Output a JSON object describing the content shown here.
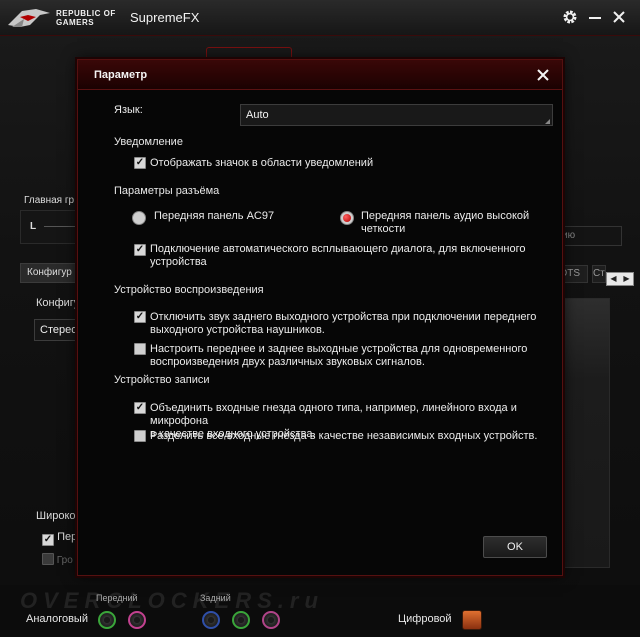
{
  "app": {
    "brand_line1": "REPUBLIC OF",
    "brand_line2": "GAMERS",
    "title": "SupremeFX",
    "main_group_label": "Главная гр",
    "slider_left_label": "L",
    "right_box_text": "анию",
    "tab_config": "Конфигур",
    "tab_dts": "DTS",
    "tab_extra": "Ст",
    "config_label": "Конфигу",
    "config_value": "Стерео",
    "wide_label": "Широко",
    "wide_check_label": "Пер",
    "group_check_label": "Гро"
  },
  "bottom": {
    "analog_label": "Аналоговый",
    "front_label": "Передний",
    "rear_label": "Задний",
    "digital_label": "Цифровой",
    "watermark": "OVERCLOCKERS.ru"
  },
  "dialog": {
    "title": "Параметр",
    "language_label": "Язык:",
    "language_value": "Auto",
    "notification_section": "Уведомление",
    "show_tray_icon": {
      "label": "Отображать значок в области уведомлений",
      "checked": true
    },
    "jack_section": "Параметры разъёма",
    "radio_ac97": {
      "label": "Передняя панель AC97",
      "selected": false
    },
    "radio_hd": {
      "label_line1": "Передняя панель аудио высокой",
      "label_line2": "четкости",
      "selected": true
    },
    "auto_popup": {
      "label_line1": "Подключение автоматического всплывающего диалога, для включенного",
      "label_line2": "устройства",
      "checked": true
    },
    "playback_section": "Устройство воспроизведения",
    "mute_rear": {
      "label_line1": "Отключить звук заднего выходного устройства при подключении переднего",
      "label_line2": "выходного устройства наушников.",
      "checked": true
    },
    "separate_streams": {
      "label_line1": "Настроить переднее и заднее выходные устройства для одновременного",
      "label_line2": "воспроизведения двух различных звуковых сигналов.",
      "checked": false
    },
    "record_section": "Устройство записи",
    "combine_inputs": {
      "label_line1": "Объединить входные гнезда одного типа, например, линейного входа и микрофона",
      "label_line2": "в качестве входного устройства.",
      "checked": true
    },
    "split_inputs": {
      "label": "Разделить все входные гнезда в качестве независимых входных устройств.",
      "checked": false
    },
    "ok_label": "OK"
  },
  "colors": {
    "accent_red": "#b00000",
    "dialog_title_bg": "#2a0404",
    "jack_green": "#3aa53a",
    "jack_pink": "#c2418f",
    "jack_blue": "#2f4fa8",
    "jack_pink_rear": "#b04488"
  },
  "icons": {
    "logo": "rog-eye-logo",
    "settings": "gear-icon",
    "minimize": "minimize-icon",
    "close": "close-icon",
    "digital": "digital-output-icon"
  }
}
